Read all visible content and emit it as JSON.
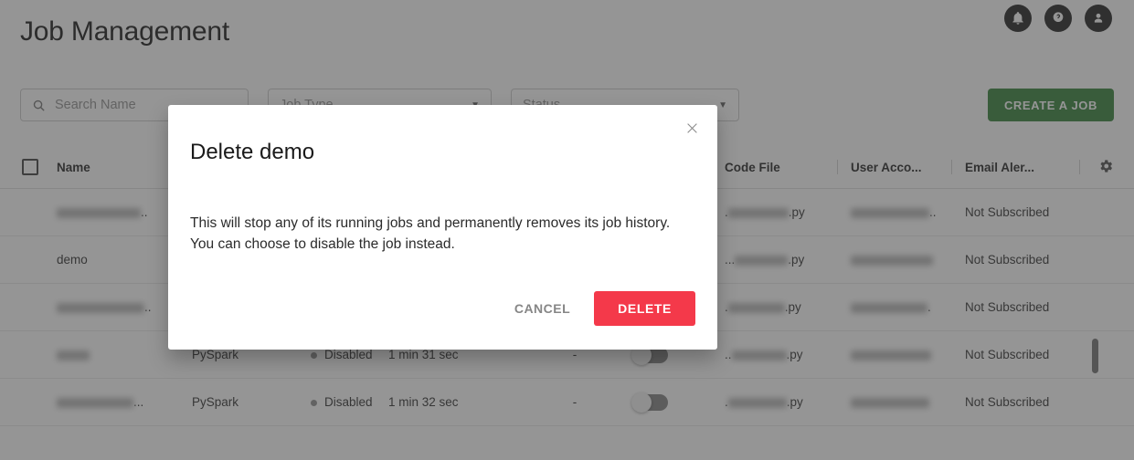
{
  "header": {
    "title": "Job Management",
    "icons": [
      {
        "name": "notifications-bell-icon",
        "glyph": "bell"
      },
      {
        "name": "help-question-icon",
        "glyph": "question"
      },
      {
        "name": "account-avatar-icon",
        "glyph": "person"
      }
    ]
  },
  "filters": {
    "search_placeholder": "Search Name",
    "search_value": "",
    "job_type_label": "Job Type",
    "status_label": "Status",
    "create_button": "CREATE A JOB"
  },
  "table": {
    "columns": {
      "name": "Name",
      "code_file": "Code File",
      "user_account": "User Acco...",
      "email_alert": "Email Aler..."
    },
    "rows": [
      {
        "name": "",
        "name_redacted": true,
        "name_ellipsis": "..",
        "type": "",
        "status": "",
        "duration": "",
        "dash": "",
        "code_file_prefix": ".",
        "code_file_suffix": ".py",
        "user_account_ellipsis": "..",
        "email_alert": "Not Subscribed"
      },
      {
        "name": "demo",
        "name_redacted": false,
        "name_ellipsis": "",
        "type": "",
        "status": "",
        "duration": "",
        "dash": "",
        "code_file_prefix": "...",
        "code_file_suffix": ".py",
        "user_account_ellipsis": "",
        "email_alert": "Not Subscribed"
      },
      {
        "name": "",
        "name_redacted": true,
        "name_ellipsis": "..",
        "type": "",
        "status": "",
        "duration": "",
        "dash": "",
        "code_file_prefix": ".",
        "code_file_suffix": ".py",
        "user_account_ellipsis": ".",
        "email_alert": "Not Subscribed"
      },
      {
        "name": "",
        "name_redacted": true,
        "name_ellipsis": "",
        "type": "PySpark",
        "status": "Disabled",
        "duration": "1 min 31 sec",
        "dash": "-",
        "code_file_prefix": "..",
        "code_file_suffix": ".py",
        "user_account_ellipsis": "",
        "email_alert": "Not Subscribed"
      },
      {
        "name": "",
        "name_redacted": true,
        "name_ellipsis": "...",
        "type": "PySpark",
        "status": "Disabled",
        "duration": "1 min 32 sec",
        "dash": "-",
        "code_file_prefix": ".",
        "code_file_suffix": ".py",
        "user_account_ellipsis": "",
        "email_alert": "Not Subscribed"
      }
    ]
  },
  "modal": {
    "title": "Delete demo",
    "body": "This will stop any of its running jobs and permanently removes its job history. You can choose to disable the job instead.",
    "cancel_label": "CANCEL",
    "delete_label": "DELETE"
  },
  "colors": {
    "delete_red": "#f4394a",
    "create_green": "#2f7d32",
    "overlay": "#8b8b8b"
  }
}
